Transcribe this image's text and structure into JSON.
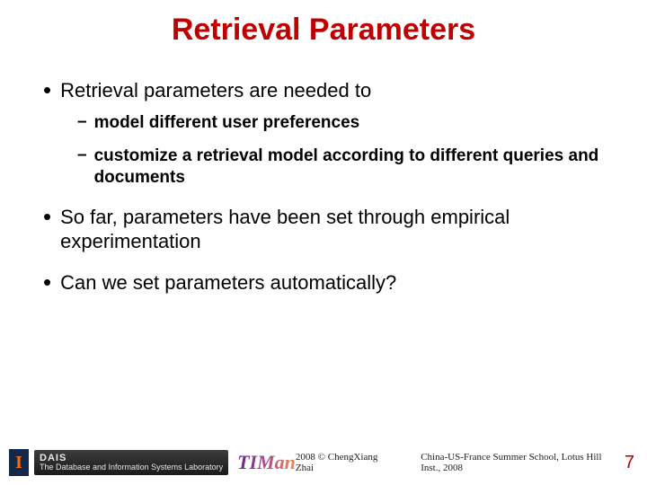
{
  "title": "Retrieval Parameters",
  "bullets": [
    {
      "text": "Retrieval parameters are needed to",
      "sub": [
        "model different user preferences",
        "customize a retrieval model according to different queries and documents"
      ]
    },
    {
      "text": "So far, parameters have been set through empirical experimentation",
      "sub": []
    },
    {
      "text": "Can we set parameters automatically?",
      "sub": []
    }
  ],
  "footer": {
    "logo_i": "I",
    "dais_top": "DAIS",
    "dais_bottom": "The Database and Information Systems Laboratory",
    "timan": "TIMan",
    "copyright": "2008 © ChengXiang Zhai",
    "venue": "China-US-France Summer School, Lotus Hill Inst., 2008",
    "page": "7"
  }
}
